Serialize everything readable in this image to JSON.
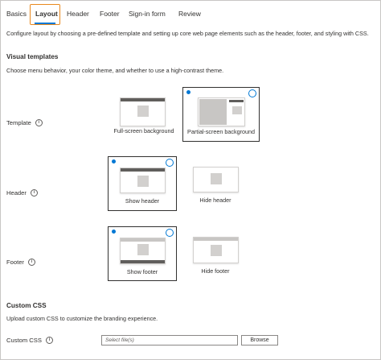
{
  "tabs": [
    {
      "label": "Basics"
    },
    {
      "label": "Layout"
    },
    {
      "label": "Header"
    },
    {
      "label": "Footer"
    },
    {
      "label": "Sign-in form"
    },
    {
      "label": "Review"
    }
  ],
  "description": "Configure layout by choosing a pre-defined template and setting up core web page elements such as the header, footer, and styling with CSS.",
  "visual_templates": {
    "title": "Visual templates",
    "subtitle": "Choose menu behavior, your color theme, and whether to use a high-contrast theme."
  },
  "template": {
    "label": "Template",
    "options": [
      {
        "label": "Full-screen background",
        "selected": false
      },
      {
        "label": "Partial-screen background",
        "selected": true
      }
    ]
  },
  "header": {
    "label": "Header",
    "options": [
      {
        "label": "Show header",
        "selected": true
      },
      {
        "label": "Hide header",
        "selected": false
      }
    ]
  },
  "footer": {
    "label": "Footer",
    "options": [
      {
        "label": "Show footer",
        "selected": true
      },
      {
        "label": "Hide footer",
        "selected": false
      }
    ]
  },
  "custom_css": {
    "title": "Custom CSS",
    "subtitle": "Upload custom CSS to customize the branding experience.",
    "label": "Custom CSS",
    "placeholder": "Select file(s)",
    "browse_label": "Browse"
  },
  "colors": {
    "accent": "#0078d4",
    "focus": "#e8881e"
  }
}
